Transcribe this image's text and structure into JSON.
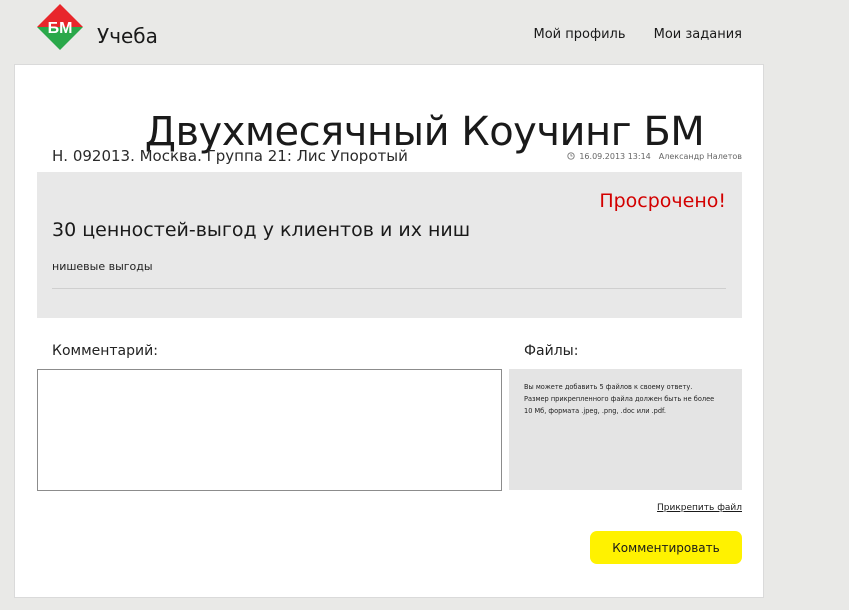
{
  "header": {
    "logo_text": "БМ",
    "brand": "Учеба",
    "nav": [
      {
        "label": "Мой профиль"
      },
      {
        "label": "Мои задания"
      }
    ]
  },
  "page": {
    "title": "Двухмесячный Коучинг БМ",
    "group": "Н. 092013. Москва. Группа 21: Лис Упоротый",
    "timestamp": "16.09.2013 13:14",
    "author": "Александр Налетов"
  },
  "task": {
    "status": "Просрочено!",
    "title": "30 ценностей-выгод у клиентов и их ниш",
    "description": "нишевые выгоды"
  },
  "comment": {
    "label": "Комментарий:",
    "value": ""
  },
  "files": {
    "label": "Файлы:",
    "info_lines": [
      "Вы можете добавить 5 файлов к своему ответу.",
      "Размер прикрепленного файла должен быть не более",
      "10 Мб, формата .jpeg, .png, .doc или .pdf."
    ],
    "attach_label": "Прикрепить файл"
  },
  "actions": {
    "submit_label": "Комментировать"
  },
  "colors": {
    "accent_yellow": "#fff200",
    "overdue_red": "#d30000",
    "logo_red": "#e8262b",
    "logo_green": "#2aa84a"
  }
}
